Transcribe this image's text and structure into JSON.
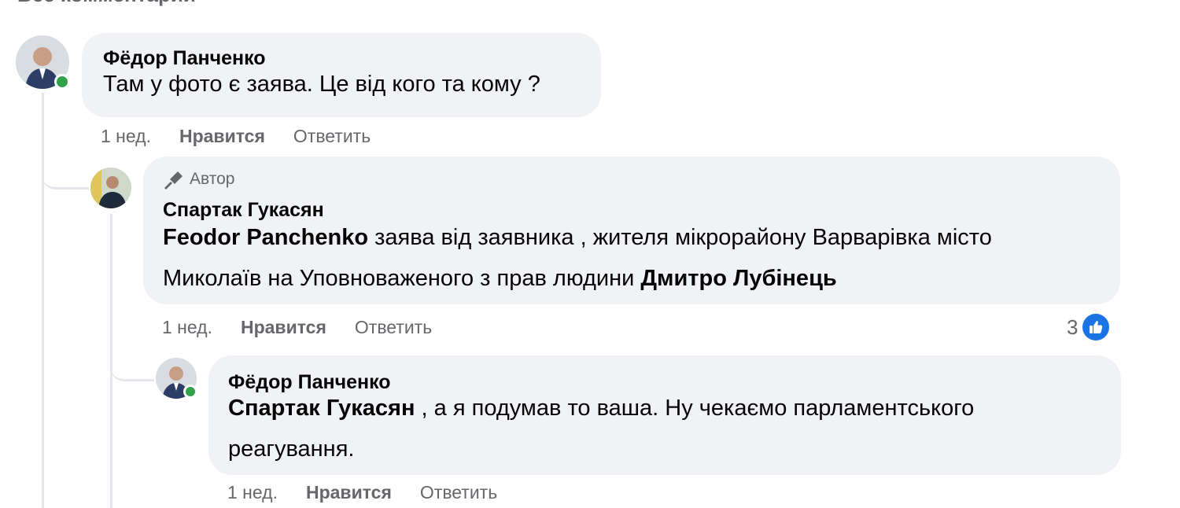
{
  "header": {
    "label": "Все комментарии",
    "chevron_icon": "chevron-down-icon"
  },
  "comments": [
    {
      "author": "Фёдор Панченко",
      "online": true,
      "text": "Там у фото є заява. Це від кого та кому ?",
      "time": "1 нед.",
      "like_label": "Нравится",
      "reply_label": "Ответить"
    },
    {
      "badge": "Автор",
      "author": "Спартак Гукасян",
      "mention": "Feodor Panchenko",
      "text_part1": " заява від заявника , жителя мікрорайону Варварівка місто Миколаїв на Уповноваженого з прав людини ",
      "mention2": "Дмитро Лубінець",
      "time": "1 нед.",
      "like_label": "Нравится",
      "reply_label": "Ответить",
      "reaction_count": "3"
    },
    {
      "author": "Фёдор Панченко",
      "online": true,
      "mention": "Спартак Гукасян",
      "text_part1": " , а я подумав то ваша. Ну чекаємо парламентського реагування.",
      "time": "1 нед.",
      "like_label": "Нравится",
      "reply_label": "Ответить"
    }
  ],
  "colors": {
    "bubble": "#f0f2f5",
    "muted": "#65676b",
    "online": "#31a24c",
    "like": "#1b74e4"
  }
}
